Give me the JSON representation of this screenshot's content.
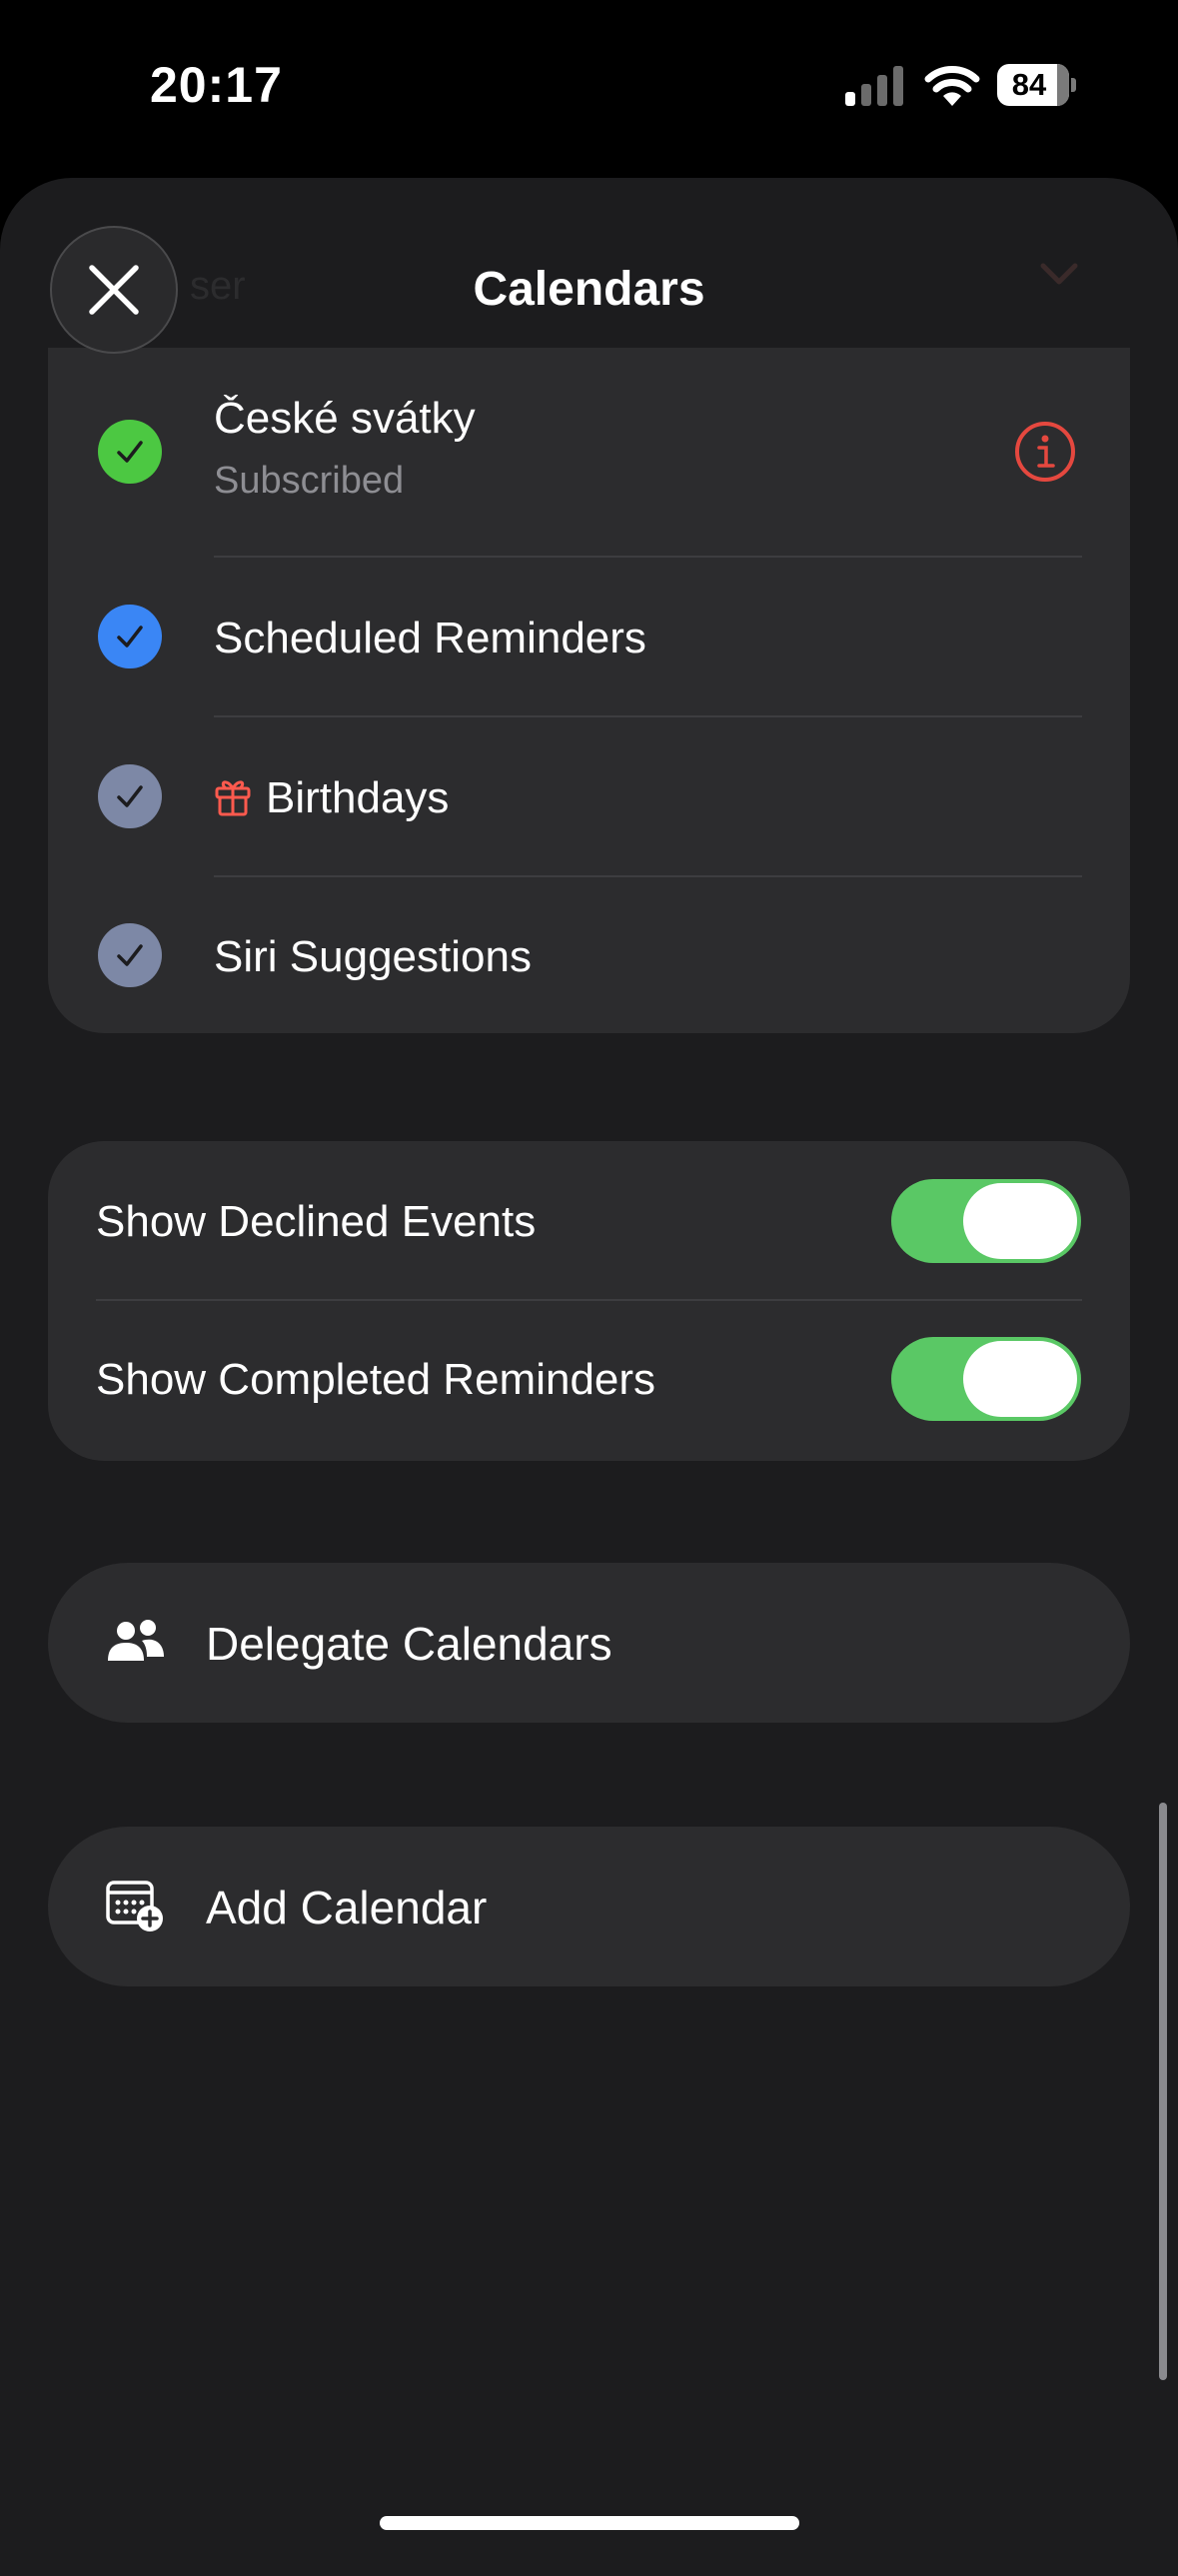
{
  "status": {
    "time": "20:17",
    "battery": "84"
  },
  "sheet": {
    "title": "Calendars",
    "header_ghost": "ser"
  },
  "calendars": [
    {
      "name": "České svátky",
      "subtitle": "Subscribed",
      "color": "#4cc842",
      "has_info": true
    },
    {
      "name": "Scheduled Reminders",
      "color": "#3a86f5"
    },
    {
      "name": "Birthdays",
      "color": "#7d88a6",
      "icon": "gift-icon"
    },
    {
      "name": "Siri Suggestions",
      "color": "#7d88a6"
    }
  ],
  "toggles": [
    {
      "label": "Show Declined Events",
      "on": true
    },
    {
      "label": "Show Completed Reminders",
      "on": true
    }
  ],
  "actions": {
    "delegate": {
      "label": "Delegate Calendars",
      "icon": "people-icon"
    },
    "add": {
      "label": "Add Calendar",
      "icon": "add-calendar-icon"
    }
  },
  "colors": {
    "toggle_on": "#5ac865",
    "info_accent": "#e5483f",
    "gift_accent": "#ff5a4e"
  }
}
